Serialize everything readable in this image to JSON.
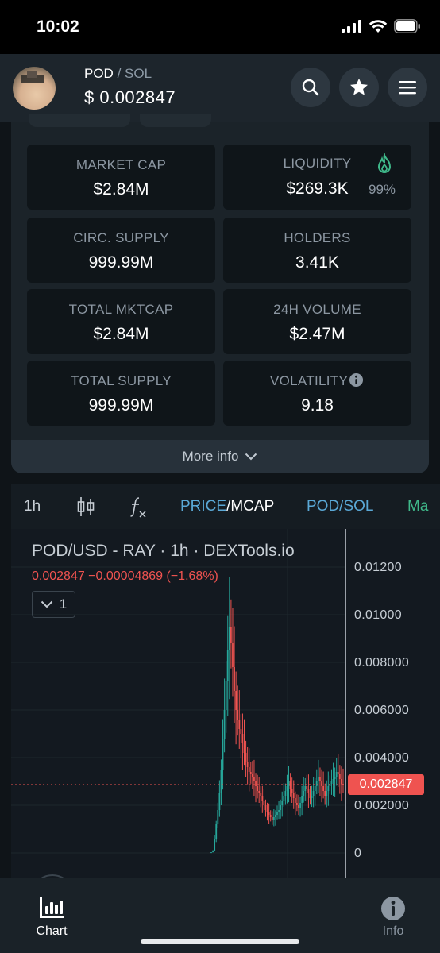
{
  "status_bar": {
    "time": "10:02"
  },
  "header": {
    "base_symbol": "POD",
    "separator": "/",
    "quote_symbol": "SOL",
    "price_display": "$ 0.002847"
  },
  "stats": [
    {
      "label": "MARKET CAP",
      "value": "$2.84M"
    },
    {
      "label": "LIQUIDITY",
      "value": "$269.3K",
      "badge": "99%"
    },
    {
      "label": "CIRC. SUPPLY",
      "value": "999.99M"
    },
    {
      "label": "HOLDERS",
      "value": "3.41K"
    },
    {
      "label": "TOTAL MKTCAP",
      "value": "$2.84M"
    },
    {
      "label": "24H VOLUME",
      "value": "$2.47M"
    },
    {
      "label": "TOTAL SUPPLY",
      "value": "999.99M"
    },
    {
      "label": "VOLATILITY",
      "value": "9.18"
    }
  ],
  "more_info_label": "More info",
  "chart_toolbar": {
    "interval": "1h",
    "price_label": "PRICE",
    "mcap_label": "/MCAP",
    "pair_label": "POD/SOL",
    "next_label": "Ma"
  },
  "chart": {
    "title": "POD/USD - RAY · 1h · DEXTools.io",
    "ohlc": "0.002847  −0.00004869 (−1.68%)",
    "indicator_count": "1",
    "y_ticks": [
      "0.01200",
      "0.01000",
      "0.008000",
      "0.006000",
      "0.004000",
      "0.002000",
      "0"
    ],
    "last_price": "0.002847",
    "colors": {
      "up": "#26a69a",
      "down": "#ef5350",
      "accent": "#5aa8d6"
    }
  },
  "chart_data": {
    "type": "candlestick",
    "title": "POD/USD - RAY · 1h · DEXTools.io",
    "ylim": [
      0,
      0.012
    ],
    "last_price": 0.002847,
    "close_series_approx": [
      3e-05,
      0.0001,
      0.0006,
      0.0012,
      0.0018,
      0.0025,
      0.0035,
      0.0048,
      0.006,
      0.0072,
      0.0085,
      0.0095,
      0.0088,
      0.0078,
      0.0068,
      0.006,
      0.0056,
      0.0052,
      0.005,
      0.0046,
      0.0042,
      0.0038,
      0.0036,
      0.0034,
      0.0033,
      0.0032,
      0.003,
      0.0028,
      0.0026,
      0.0025,
      0.0024,
      0.0022,
      0.002,
      0.0018,
      0.0017,
      0.0016,
      0.0015,
      0.0014,
      0.0015,
      0.0016,
      0.0017,
      0.0018,
      0.002,
      0.0022,
      0.0024,
      0.0026,
      0.0028,
      0.003,
      0.0027,
      0.0025,
      0.0023,
      0.0021,
      0.002,
      0.0019,
      0.0021,
      0.0024,
      0.0026,
      0.0028,
      0.0027,
      0.0025,
      0.0023,
      0.0024,
      0.0026,
      0.0028,
      0.003,
      0.0032,
      0.003,
      0.0028,
      0.0026,
      0.0024,
      0.0026,
      0.0028,
      0.0029,
      0.003,
      0.0031,
      0.0032,
      0.0034,
      0.0033,
      0.0031,
      0.0029,
      0.002847
    ]
  },
  "bottom_nav": {
    "chart_label": "Chart",
    "info_label": "Info"
  }
}
